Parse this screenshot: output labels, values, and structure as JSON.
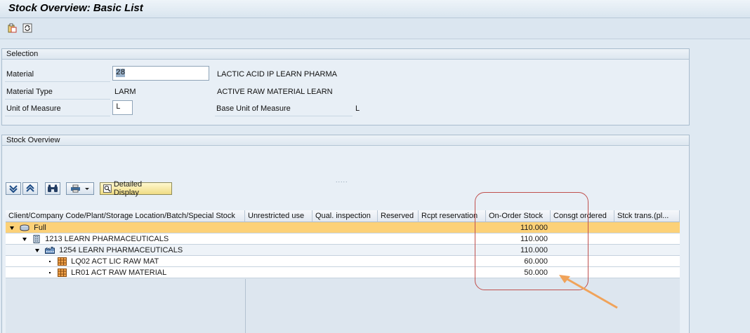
{
  "window": {
    "title": "Stock Overview: Basic List"
  },
  "toolbar": {
    "icons": [
      "clipboard-icon",
      "refresh-icon"
    ]
  },
  "selection": {
    "header": "Selection",
    "material_label": "Material",
    "material_value": "28",
    "material_desc": "LACTIC ACID IP LEARN PHARMA",
    "material_type_label": "Material Type",
    "material_type_value": "LARM",
    "material_type_desc": "ACTIVE RAW MATERIAL LEARN",
    "uom_label": "Unit of Measure",
    "uom_value": "L",
    "base_uom_label": "Base Unit of Measure",
    "base_uom_value": "L"
  },
  "stock_overview": {
    "header": "Stock Overview",
    "detail_button": "Detailed Display",
    "columns": [
      "Client/Company Code/Plant/Storage Location/Batch/Special Stock",
      "Unrestricted use",
      "Qual. inspection",
      "Reserved",
      "Rcpt reservation",
      "On-Order Stock",
      "Consgt ordered",
      "Stck trans.(pl..."
    ],
    "rows": [
      {
        "label": "Full",
        "on_order": "110.000"
      },
      {
        "label": "1213 LEARN PHARMACEUTICALS",
        "on_order": "110.000"
      },
      {
        "label": "1254 LEARN PHARMACEUTICALS",
        "on_order": "110.000"
      },
      {
        "label": "LQ02 ACT LIC RAW MAT",
        "on_order": "60.000"
      },
      {
        "label": "LR01 ACT RAW MATERIAL",
        "on_order": "50.000"
      }
    ]
  },
  "colors": {
    "selected_row": "#fcd178",
    "annotation_box": "#c0504d",
    "annotation_arrow": "#f0a35a"
  }
}
